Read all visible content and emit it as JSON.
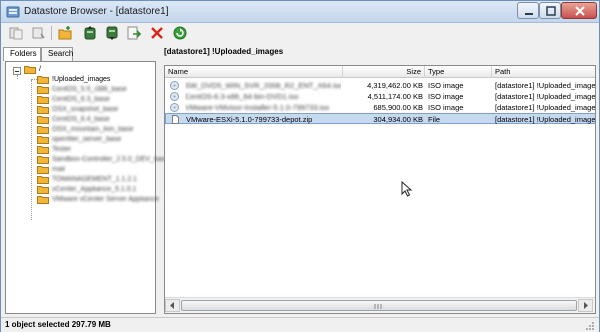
{
  "window": {
    "title": "Datastore Browser - [datastore1]"
  },
  "toolbar": {
    "buttons": [
      {
        "id": "refresh-back",
        "icon": "browse-back-icon"
      },
      {
        "id": "browse",
        "icon": "browse-forward-icon"
      },
      {
        "id": "new-folder",
        "icon": "new-folder-icon"
      },
      {
        "id": "upload",
        "icon": "upload-icon"
      },
      {
        "id": "download",
        "icon": "download-icon"
      },
      {
        "id": "move",
        "icon": "move-file-icon"
      },
      {
        "id": "delete",
        "icon": "delete-icon"
      },
      {
        "id": "refresh",
        "icon": "refresh-icon"
      }
    ]
  },
  "tabs": {
    "folders": "Folders",
    "search": "Search"
  },
  "tree": {
    "root": "/",
    "items": [
      {
        "label": "!Uploaded_images",
        "blurred": false
      },
      {
        "label": "CentOS_5.5_i386_base",
        "blurred": true
      },
      {
        "label": "CentOS_6.3_base",
        "blurred": true
      },
      {
        "label": "OSX_snapshot_base",
        "blurred": true
      },
      {
        "label": "CentOS_6.4_base",
        "blurred": true
      },
      {
        "label": "OSX_mountain_lion_base",
        "blurred": true
      },
      {
        "label": "openfiler_server_base",
        "blurred": true
      },
      {
        "label": "Tester",
        "blurred": true
      },
      {
        "label": "Sandbox-Controller_2.5.0_DEV_base",
        "blurred": true
      },
      {
        "label": "mail",
        "blurred": true
      },
      {
        "label": "TOMANAGEMENT_1.1.2.1",
        "blurred": true
      },
      {
        "label": "vCenter_Appliance_5.1.0.1",
        "blurred": true
      },
      {
        "label": "VMware vCenter Server Appliance",
        "blurred": true
      }
    ]
  },
  "main": {
    "path": "[datastore1] !Uploaded_images"
  },
  "table": {
    "columns": [
      "Name",
      "Size",
      "Type",
      "Path"
    ],
    "rows": [
      {
        "name": "SW_DVD5_WIN_SVR_2008_R2_ENT_X64.iso",
        "size": "4,319,462.00 KB",
        "type": "ISO image",
        "path": "[datastore1] !Uploaded_image",
        "blurred": true,
        "icon": "iso-file-icon"
      },
      {
        "name": "CentOS-6.3-x86_64-bin-DVD1.iso",
        "size": "4,511,174.00 KB",
        "type": "ISO image",
        "path": "[datastore1] !Uploaded_image",
        "blurred": true,
        "icon": "iso-file-icon"
      },
      {
        "name": "VMware-VMvisor-Installer-5.1.0-799733.iso",
        "size": "685,900.00 KB",
        "type": "ISO image",
        "path": "[datastore1] !Uploaded_image",
        "blurred": true,
        "icon": "iso-file-icon"
      },
      {
        "name": "VMware-ESXi-5.1.0-799733-depot.zip",
        "size": "304,934.00 KB",
        "type": "File",
        "path": "[datastore1] !Uploaded_image",
        "blurred": false,
        "selected": true,
        "icon": "file-icon"
      }
    ]
  },
  "status": {
    "text": "1 object selected 297.79 MB"
  },
  "colors": {
    "selection": "#c5d9ef",
    "folder": "#f2b53a",
    "delete": "#d9261c",
    "refresh": "#3aa13a"
  }
}
